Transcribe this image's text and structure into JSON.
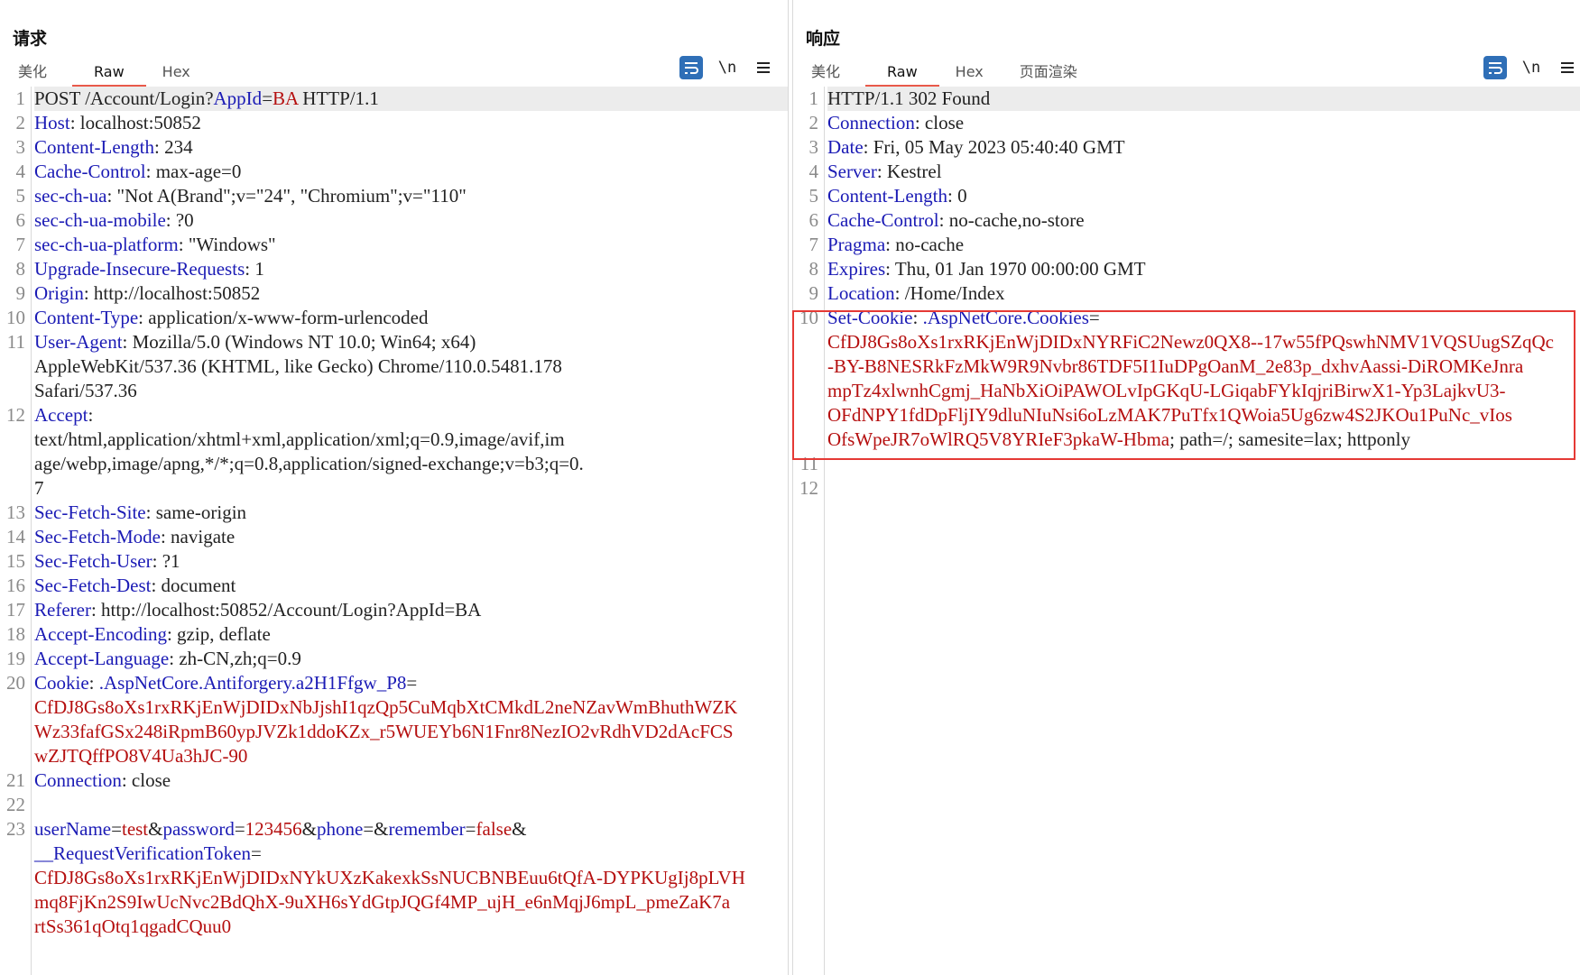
{
  "request": {
    "title": "请求",
    "tabs": [
      {
        "label": "美化",
        "active": false
      },
      {
        "label": "Raw",
        "active": true
      },
      {
        "label": "Hex",
        "active": false
      }
    ],
    "tools": {
      "newline_label": "\\n",
      "menu_icon": "hamburger-icon",
      "wrap_icon": "wrap-lines-icon"
    },
    "lines": [
      {
        "n": "1",
        "highlight": true,
        "segs": [
          [
            "t",
            "POST /Account/Login?"
          ],
          [
            "k",
            "AppId"
          ],
          [
            "t",
            "="
          ],
          [
            "v",
            "BA"
          ],
          [
            "t",
            " HTTP/1.1"
          ]
        ]
      },
      {
        "n": "2",
        "segs": [
          [
            "k",
            "Host"
          ],
          [
            "t",
            ": localhost:50852"
          ]
        ]
      },
      {
        "n": "3",
        "segs": [
          [
            "k",
            "Content-Length"
          ],
          [
            "t",
            ": 234"
          ]
        ]
      },
      {
        "n": "4",
        "segs": [
          [
            "k",
            "Cache-Control"
          ],
          [
            "t",
            ": max-age=0"
          ]
        ]
      },
      {
        "n": "5",
        "segs": [
          [
            "k",
            "sec-ch-ua"
          ],
          [
            "t",
            ": \"Not A(Brand\";v=\"24\", \"Chromium\";v=\"110\""
          ]
        ]
      },
      {
        "n": "6",
        "segs": [
          [
            "k",
            "sec-ch-ua-mobile"
          ],
          [
            "t",
            ": ?0"
          ]
        ]
      },
      {
        "n": "7",
        "segs": [
          [
            "k",
            "sec-ch-ua-platform"
          ],
          [
            "t",
            ": \"Windows\""
          ]
        ]
      },
      {
        "n": "8",
        "segs": [
          [
            "k",
            "Upgrade-Insecure-Requests"
          ],
          [
            "t",
            ": 1"
          ]
        ]
      },
      {
        "n": "9",
        "segs": [
          [
            "k",
            "Origin"
          ],
          [
            "t",
            ": http://localhost:50852"
          ]
        ]
      },
      {
        "n": "10",
        "segs": [
          [
            "k",
            "Content-Type"
          ],
          [
            "t",
            ": application/x-www-form-urlencoded"
          ]
        ]
      },
      {
        "n": "11",
        "segs": [
          [
            "k",
            "User-Agent"
          ],
          [
            "t",
            ": Mozilla/5.0 (Windows NT 10.0; Win64; x64)\nAppleWebKit/537.36 (KHTML, like Gecko) Chrome/110.0.5481.178\nSafari/537.36"
          ]
        ]
      },
      {
        "n": "12",
        "segs": [
          [
            "k",
            "Accept"
          ],
          [
            "t",
            ":\ntext/html,application/xhtml+xml,application/xml;q=0.9,image/avif,im\nage/webp,image/apng,*/*;q=0.8,application/signed-exchange;v=b3;q=0.\n7"
          ]
        ]
      },
      {
        "n": "13",
        "segs": [
          [
            "k",
            "Sec-Fetch-Site"
          ],
          [
            "t",
            ": same-origin"
          ]
        ]
      },
      {
        "n": "14",
        "segs": [
          [
            "k",
            "Sec-Fetch-Mode"
          ],
          [
            "t",
            ": navigate"
          ]
        ]
      },
      {
        "n": "15",
        "segs": [
          [
            "k",
            "Sec-Fetch-User"
          ],
          [
            "t",
            ": ?1"
          ]
        ]
      },
      {
        "n": "16",
        "segs": [
          [
            "k",
            "Sec-Fetch-Dest"
          ],
          [
            "t",
            ": document"
          ]
        ]
      },
      {
        "n": "17",
        "segs": [
          [
            "k",
            "Referer"
          ],
          [
            "t",
            ": http://localhost:50852/Account/Login?AppId=BA"
          ]
        ]
      },
      {
        "n": "18",
        "segs": [
          [
            "k",
            "Accept-Encoding"
          ],
          [
            "t",
            ": gzip, deflate"
          ]
        ]
      },
      {
        "n": "19",
        "segs": [
          [
            "k",
            "Accept-Language"
          ],
          [
            "t",
            ": zh-CN,zh;q=0.9"
          ]
        ]
      },
      {
        "n": "20",
        "segs": [
          [
            "k",
            "Cookie"
          ],
          [
            "t",
            ": "
          ],
          [
            "k",
            ".AspNetCore.Antiforgery.a2H1Ffgw_P8"
          ],
          [
            "t",
            "="
          ],
          [
            "v",
            "\nCfDJ8Gs8oXs1rxRKjEnWjDIDxNbJjshI1qzQp5CuMqbXtCMkdL2neNZavWmBhuthWZK\nWz33fafGSx248iRpmB60ypJVZk1ddoKZx_r5WUEYb6N1Fnr8NezIO2vRdhVD2dAcFCS\nwZJTQffPO8V4Ua3hJC-90"
          ]
        ]
      },
      {
        "n": "21",
        "segs": [
          [
            "k",
            "Connection"
          ],
          [
            "t",
            ": close"
          ]
        ]
      },
      {
        "n": "22",
        "segs": [
          [
            "t",
            ""
          ]
        ]
      },
      {
        "n": "23",
        "segs": [
          [
            "k",
            "userName"
          ],
          [
            "t",
            "="
          ],
          [
            "v",
            "test"
          ],
          [
            "t",
            "&"
          ],
          [
            "k",
            "password"
          ],
          [
            "t",
            "="
          ],
          [
            "v",
            "123456"
          ],
          [
            "t",
            "&"
          ],
          [
            "k",
            "phone"
          ],
          [
            "t",
            "=&"
          ],
          [
            "k",
            "remember"
          ],
          [
            "t",
            "="
          ],
          [
            "v",
            "false"
          ],
          [
            "t",
            "&\n"
          ],
          [
            "k",
            "__RequestVerificationToken"
          ],
          [
            "t",
            "="
          ],
          [
            "v",
            "\nCfDJ8Gs8oXs1rxRKjEnWjDIDxNYkUXzKakexkSsNUCBNBEuu6tQfA-DYPKUgIj8pLVH\nmq8FjKn2S9IwUcNvc2BdQhX-9uXH6sYdGtpJQGf4MP_ujH_e6nMqjJ6mpL_pmeZaK7a\nrtSs361qOtq1qgadCQuu0"
          ]
        ]
      }
    ]
  },
  "response": {
    "title": "响应",
    "tabs": [
      {
        "label": "美化",
        "active": false
      },
      {
        "label": "Raw",
        "active": true
      },
      {
        "label": "Hex",
        "active": false
      },
      {
        "label": "页面渲染",
        "active": false
      }
    ],
    "tools": {
      "newline_label": "\\n",
      "menu_icon": "hamburger-icon",
      "wrap_icon": "wrap-lines-icon"
    },
    "lines": [
      {
        "n": "1",
        "highlight": true,
        "segs": [
          [
            "t",
            "HTTP/1.1 302 Found"
          ]
        ]
      },
      {
        "n": "2",
        "segs": [
          [
            "k",
            "Connection"
          ],
          [
            "t",
            ": close"
          ]
        ]
      },
      {
        "n": "3",
        "segs": [
          [
            "k",
            "Date"
          ],
          [
            "t",
            ": Fri, 05 May 2023 05:40:40 GMT"
          ]
        ]
      },
      {
        "n": "4",
        "segs": [
          [
            "k",
            "Server"
          ],
          [
            "t",
            ": Kestrel"
          ]
        ]
      },
      {
        "n": "5",
        "segs": [
          [
            "k",
            "Content-Length"
          ],
          [
            "t",
            ": 0"
          ]
        ]
      },
      {
        "n": "6",
        "segs": [
          [
            "k",
            "Cache-Control"
          ],
          [
            "t",
            ": no-cache,no-store"
          ]
        ]
      },
      {
        "n": "7",
        "segs": [
          [
            "k",
            "Pragma"
          ],
          [
            "t",
            ": no-cache"
          ]
        ]
      },
      {
        "n": "8",
        "segs": [
          [
            "k",
            "Expires"
          ],
          [
            "t",
            ": Thu, 01 Jan 1970 00:00:00 GMT"
          ]
        ]
      },
      {
        "n": "9",
        "segs": [
          [
            "k",
            "Location"
          ],
          [
            "t",
            ": /Home/Index"
          ]
        ]
      },
      {
        "n": "10",
        "segs": [
          [
            "k",
            "Set-Cookie"
          ],
          [
            "t",
            ": "
          ],
          [
            "k",
            ".AspNetCore.Cookies"
          ],
          [
            "t",
            "="
          ],
          [
            "v",
            "\nCfDJ8Gs8oXs1rxRKjEnWjDIDxNYRFiC2Newz0QX8--17w55fPQswhNMV1VQSUugSZqQc\n-BY-B8NESRkFzMkW9R9Nvbr86TDF5I1IuDPgOanM_2e83p_dxhvAassi-DiROMKeJnra\nmpTz4xlwnhCgmj_HaNbXiOiPAWOLvIpGKqU-LGiqabFYkIqjriBirwX1-Yp3LajkvU3-\nOFdNPY1fdDpFljIY9dluNIuNsi6oLzMAK7PuTfx1QWoia5Ug6zw4S2JKOu1PuNc_vIos\nOfsWpeJR7oWlRQ5V8YRIeF3pkaW-Hbma"
          ],
          [
            "t",
            "; path=/; samesite=lax; httponly"
          ]
        ]
      },
      {
        "n": "11",
        "segs": [
          [
            "t",
            ""
          ]
        ]
      },
      {
        "n": "12",
        "segs": [
          [
            "t",
            ""
          ]
        ]
      }
    ]
  },
  "view_switch": {
    "buttons": [
      {
        "name": "side-by-side-view-icon",
        "active": true
      },
      {
        "name": "stacked-view-icon",
        "active": false
      },
      {
        "name": "single-view-icon",
        "active": false
      }
    ]
  },
  "colors": {
    "key": "#1b1bb5",
    "value": "#b50f0f",
    "accent": "#2f6fb7",
    "highlight_box": "#e53935"
  }
}
